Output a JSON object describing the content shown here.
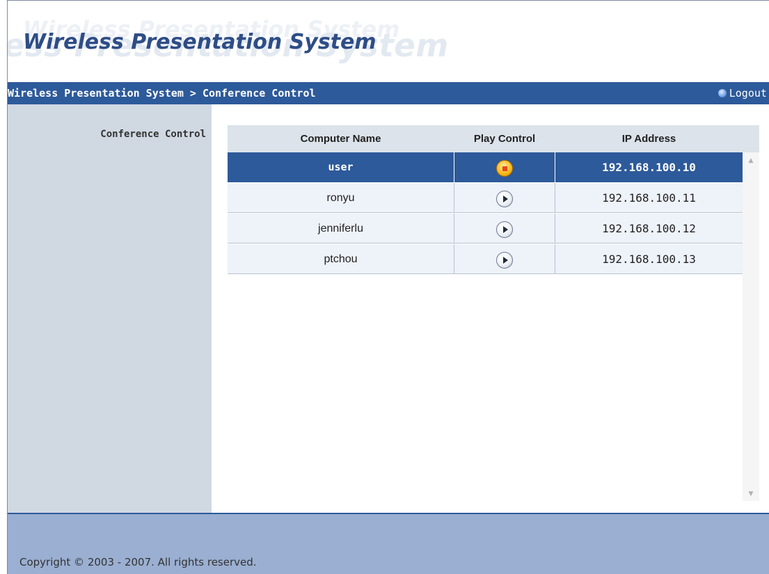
{
  "header": {
    "logo_text": "Wireless Presentation System",
    "logo_ghost_text": "less Presentation System",
    "logo_ghost_top_text": "Wireless Presentation System"
  },
  "navbar": {
    "breadcrumb": "Wireless Presentation System > Conference Control",
    "logout_label": "Logout",
    "logout_suffix": "›"
  },
  "sidebar": {
    "title": "Conference Control"
  },
  "table": {
    "columns": [
      "Computer Name",
      "Play Control",
      "IP Address"
    ],
    "rows": [
      {
        "name": "user",
        "control": "stop-icon",
        "ip": "192.168.100.10",
        "selected": true
      },
      {
        "name": "ronyu",
        "control": "play-icon",
        "ip": "192.168.100.11",
        "selected": false
      },
      {
        "name": "jenniferlu",
        "control": "play-icon",
        "ip": "192.168.100.12",
        "selected": false
      },
      {
        "name": "ptchou",
        "control": "play-icon",
        "ip": "192.168.100.13",
        "selected": false
      }
    ]
  },
  "scrollbar": {
    "up_glyph": "▲",
    "down_glyph": "▼"
  },
  "footer": {
    "copyright": "Copyright © 2003 - 2007. All rights reserved."
  },
  "colors": {
    "navbar": "#2d5a9a",
    "sidebar": "#d0d8e2",
    "footer": "#9aafd1",
    "row_selected": "#2d5a9a",
    "row_default": "#eef2f9",
    "stop_icon": "#f5b814"
  }
}
